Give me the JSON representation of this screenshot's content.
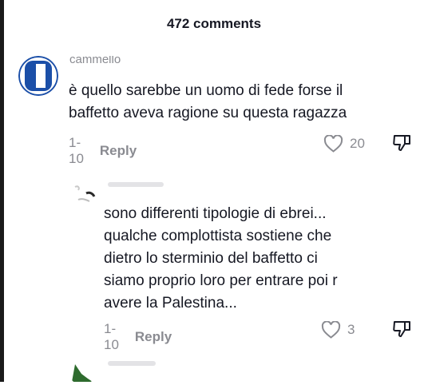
{
  "header": {
    "title": "472 comments"
  },
  "comments": [
    {
      "username": "cammello",
      "text": "è quello sarebbe un uomo di fede forse il\nbaffetto aveva ragione su questa ragazza",
      "time": "1-10",
      "reply_label": "Reply",
      "likes": "20"
    },
    {
      "username": "",
      "text": "sono differenti tipologie di ebrei...\nqualche complottista sostiene che\ndietro lo sterminio del baffetto ci\nsiamo proprio loro per entrare poi r\navere la Palestina...",
      "time": "1-10",
      "reply_label": "Reply",
      "likes": "3"
    }
  ],
  "icons": {
    "like": "heart-outline-icon",
    "dislike": "thumbs-down-icon"
  },
  "colors": {
    "text": "#161823",
    "muted": "#8a8b91",
    "avatar_primary": "#1b4fa8",
    "avatar_reply": "#2e6b2e"
  }
}
